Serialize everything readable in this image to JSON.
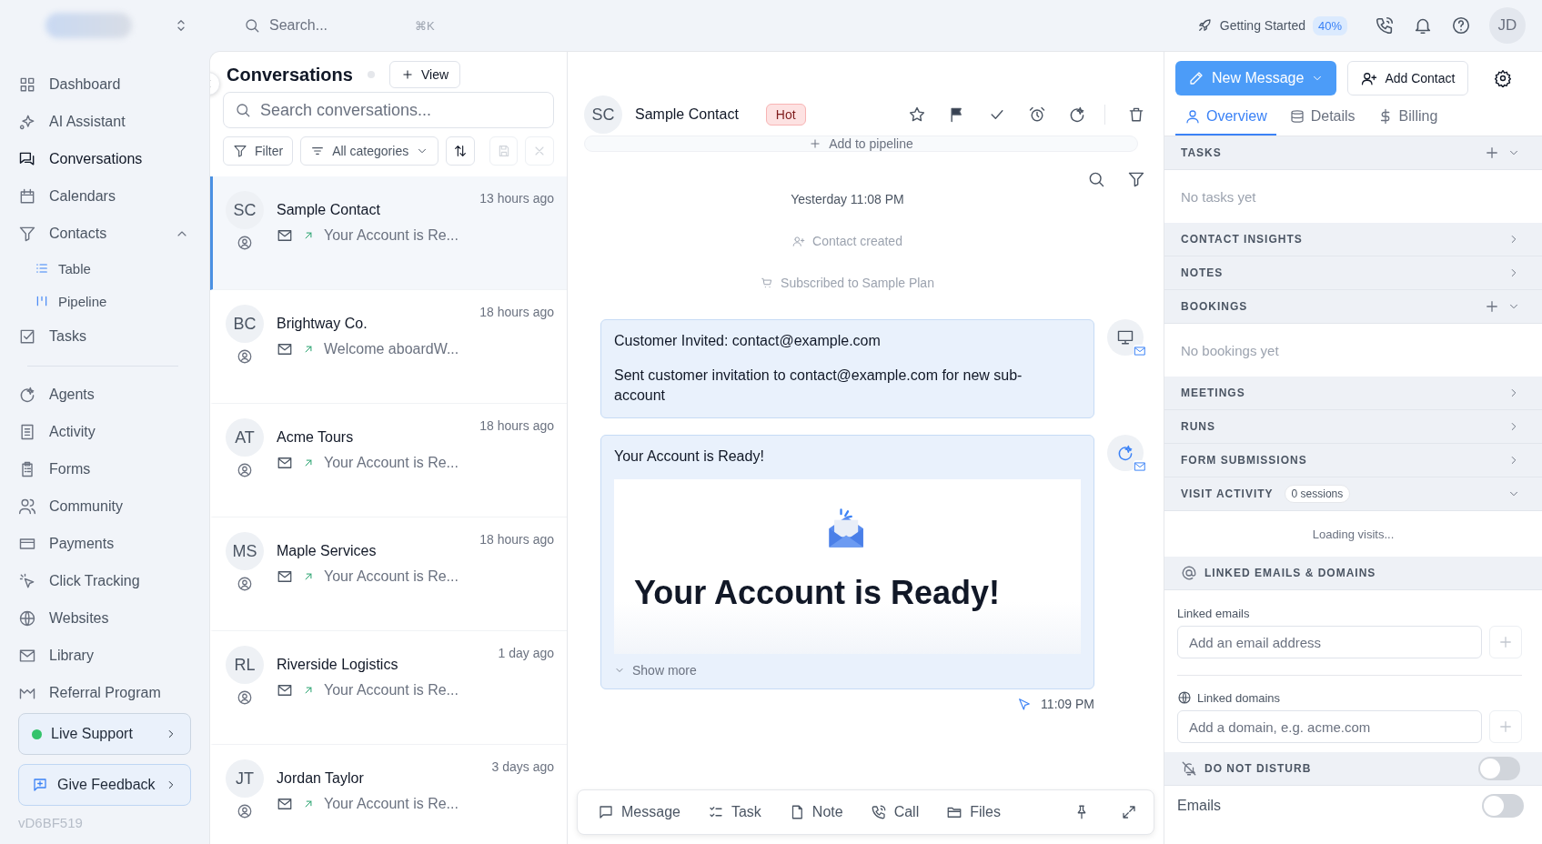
{
  "topbar": {
    "search_placeholder": "Search...",
    "shortcut": "⌘K",
    "getting_started": "Getting Started",
    "progress": "40%",
    "avatar": "JD"
  },
  "sidebar": {
    "groups": [
      [
        {
          "label": "Dashboard",
          "selected": false
        },
        {
          "label": "AI Assistant",
          "selected": false
        },
        {
          "label": "Conversations",
          "selected": true
        },
        {
          "label": "Calendars",
          "selected": false
        },
        {
          "label": "Contacts",
          "selected": false,
          "expanded": true,
          "children": [
            {
              "label": "Table",
              "selected": false
            },
            {
              "label": "Pipeline",
              "selected": false
            }
          ]
        },
        {
          "label": "Tasks",
          "selected": false
        }
      ],
      [
        {
          "label": "Agents",
          "selected": false
        },
        {
          "label": "Activity",
          "selected": false
        },
        {
          "label": "Forms",
          "selected": false
        },
        {
          "label": "Community",
          "selected": false
        },
        {
          "label": "Payments",
          "selected": false
        },
        {
          "label": "Click Tracking",
          "selected": false
        },
        {
          "label": "Websites",
          "selected": false
        },
        {
          "label": "Library",
          "selected": false
        },
        {
          "label": "Referral Program",
          "selected": false
        }
      ]
    ],
    "live_support": "Live Support",
    "feedback": "Give Feedback",
    "version": "vD6BF519"
  },
  "conversations": {
    "title": "Conversations",
    "view_button": "View",
    "search_placeholder": "Search conversations...",
    "filter": "Filter",
    "category": "All categories",
    "items": [
      {
        "initials": "SC",
        "name": "Sample Contact",
        "time": "13 hours ago",
        "preview": "Your Account is Re...",
        "selected": true
      },
      {
        "initials": "BC",
        "name": "Brightway Co.",
        "time": "18 hours ago",
        "preview": "Welcome aboardW...",
        "selected": false
      },
      {
        "initials": "AT",
        "name": "Acme Tours",
        "time": "18 hours ago",
        "preview": "Your Account is Re...",
        "selected": false
      },
      {
        "initials": "MS",
        "name": "Maple Services",
        "time": "18 hours ago",
        "preview": "Your Account is Re...",
        "selected": false
      },
      {
        "initials": "RL",
        "name": "Riverside Logistics",
        "time": "1 day ago",
        "preview": "Your Account is Re...",
        "selected": false
      },
      {
        "initials": "JT",
        "name": "Jordan Taylor",
        "time": "3 days ago",
        "preview": "Your Account is Re...",
        "selected": false
      }
    ]
  },
  "contact": {
    "initials": "SC",
    "name": "Sample Contact",
    "tag": "Hot",
    "add_to_pipeline": "Add to pipeline"
  },
  "timeline": {
    "date": "Yesterday 11:08 PM",
    "events": [
      "Contact created",
      "Subscribed to Sample Plan"
    ],
    "messages": [
      {
        "kind": "activity",
        "title": "Customer Invited: contact@example.com",
        "body": "Sent customer invitation to contact@example.com for new sub-account"
      },
      {
        "kind": "email",
        "subject": "Your Account is Ready!",
        "heading": "Your Account is Ready!",
        "show_more": "Show more"
      }
    ],
    "time": "11:09 PM"
  },
  "composer": {
    "actions": [
      "Message",
      "Task",
      "Note",
      "Call",
      "Files"
    ]
  },
  "details": {
    "new_message": "New Message",
    "add_contact": "Add Contact",
    "tabs": [
      {
        "label": "Overview",
        "selected": true
      },
      {
        "label": "Details",
        "selected": false
      },
      {
        "label": "Billing",
        "selected": false
      }
    ],
    "sections": [
      {
        "title": "TASKS",
        "expanded": true,
        "addable": true,
        "kind": "empty",
        "body": "No tasks yet"
      },
      {
        "title": "CONTACT INSIGHTS",
        "expanded": false
      },
      {
        "title": "NOTES",
        "expanded": false
      },
      {
        "title": "BOOKINGS",
        "expanded": true,
        "addable": true,
        "kind": "empty",
        "body": "No bookings yet"
      },
      {
        "title": "MEETINGS",
        "expanded": false
      },
      {
        "title": "RUNS",
        "expanded": false
      },
      {
        "title": "FORM SUBMISSIONS",
        "expanded": false
      },
      {
        "title": "VISIT ACTIVITY",
        "badge": "0 sessions",
        "expanded": true,
        "kind": "loading",
        "body": "Loading visits..."
      }
    ],
    "linked": {
      "title": "LINKED EMAILS & DOMAINS",
      "emails_label": "Linked emails",
      "email_placeholder": "Add an email address",
      "domains_label": "Linked domains",
      "domain_placeholder": "Add a domain, e.g. acme.com"
    },
    "do_not_disturb": {
      "title": "DO NOT DISTURB",
      "on": false
    },
    "channels": [
      {
        "label": "Emails",
        "on": false
      }
    ]
  }
}
